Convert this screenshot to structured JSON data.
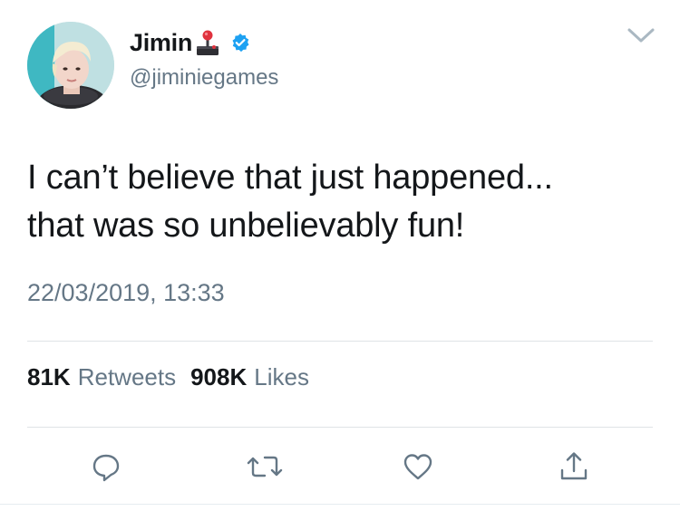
{
  "user": {
    "display_name": "Jimin",
    "name_emoji": "joystick-emoji",
    "verified_icon": "verified-badge-icon",
    "handle": "@jiminiegames",
    "avatar_icon": "profile-avatar"
  },
  "tweet": {
    "text": "I can’t believe that just happened...\nthat was so unbelievably fun!",
    "timestamp": "22/03/2019, 13:33"
  },
  "stats": {
    "retweets_count": "81K",
    "retweets_label": "Retweets",
    "likes_count": "908K",
    "likes_label": "Likes"
  },
  "actions": [
    "reply-icon",
    "retweet-icon",
    "like-icon",
    "share-icon"
  ],
  "colors": {
    "text": "#14171a",
    "secondary": "#657786",
    "verified": "#1da1f2",
    "divider": "#dfe3e6"
  }
}
